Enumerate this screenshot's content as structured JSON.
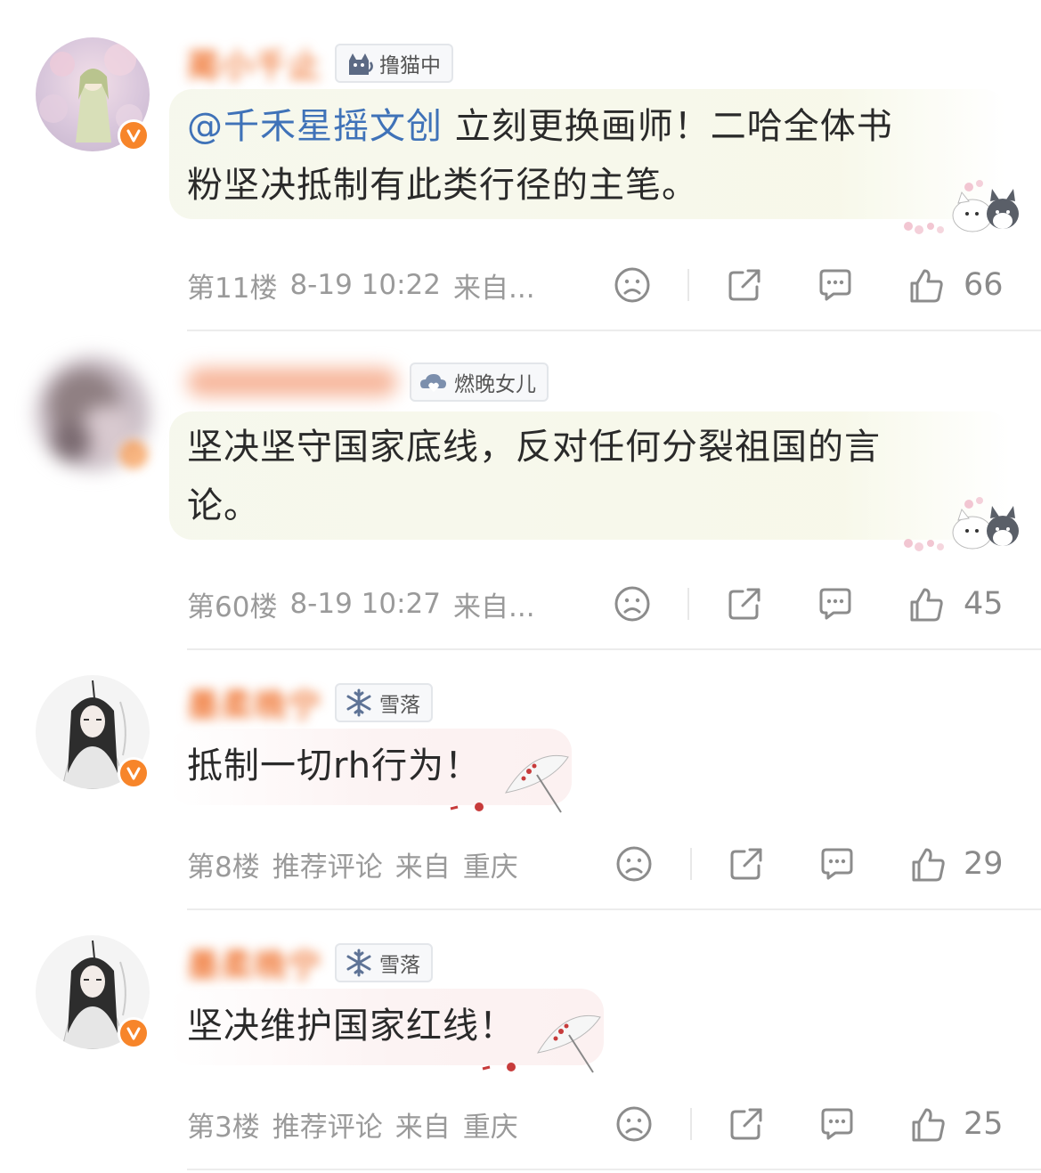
{
  "comments": [
    {
      "username": "蔺小千止",
      "badge": {
        "icon": "cat-icon",
        "text": "撸猫中"
      },
      "mention": "@千禾星摇文创",
      "text_line1": "立刻更换画师！二哈全体书",
      "text_line2": "粉坚决抵制有此类行径的主笔。",
      "floor": "第11楼",
      "time": "8-19 10:22",
      "source": "来自...",
      "likes": "66"
    },
    {
      "username": "",
      "badge": {
        "icon": "cloud-heart-icon",
        "text": "燃晚女儿"
      },
      "text_line1": "坚决坚守国家底线，反对任何分裂祖国的言",
      "text_line2": "论。",
      "floor": "第60楼",
      "time": "8-19 10:27",
      "source": "来自...",
      "likes": "45"
    },
    {
      "username": "墨柔晚宁",
      "badge": {
        "icon": "snowflake-icon",
        "text": "雪落"
      },
      "text_line1": "抵制一切rh行为！",
      "floor": "第8楼",
      "tag": "推荐评论",
      "source": "来自",
      "location": "重庆",
      "likes": "29"
    },
    {
      "username": "墨柔晚宁",
      "badge": {
        "icon": "snowflake-icon",
        "text": "雪落"
      },
      "text_line1": "坚决维护国家红线！",
      "floor": "第3楼",
      "tag": "推荐评论",
      "source": "来自",
      "location": "重庆",
      "likes": "25"
    }
  ],
  "colors": {
    "mention": "#3f72b8",
    "username": "#f07a3a",
    "verified": "#f7852a",
    "meta": "#9a9a9a"
  }
}
